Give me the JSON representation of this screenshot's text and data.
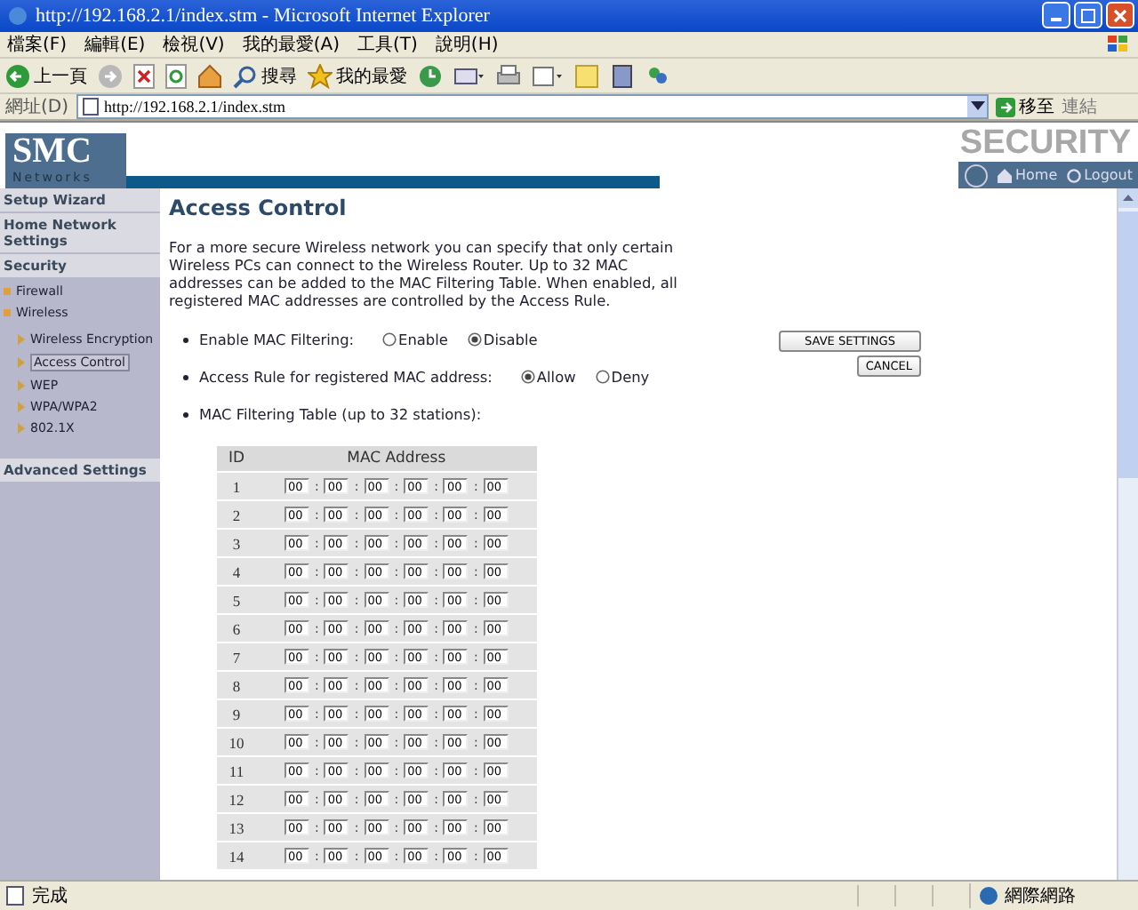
{
  "window": {
    "title": "http://192.168.2.1/index.stm - Microsoft Internet Explorer"
  },
  "menu": [
    "檔案(F)",
    "編輯(E)",
    "檢視(V)",
    "我的最愛(A)",
    "工具(T)",
    "說明(H)"
  ],
  "toolbar": [
    {
      "label": "上一頁"
    },
    {
      "label": "搜尋"
    },
    {
      "label": "我的最愛"
    }
  ],
  "address": {
    "label": "網址(D)",
    "value": "http://192.168.2.1/index.stm",
    "go": "移至",
    "links": "連結"
  },
  "header": {
    "logo": "SMC",
    "logo_sub": "Networks",
    "section": "SECURITY",
    "links": [
      "Home",
      "Logout"
    ]
  },
  "sidebar": [
    {
      "label": "Setup Wizard",
      "selected": false
    },
    {
      "label": "Home Network Settings",
      "selected": false
    },
    {
      "label": "Security",
      "selected": false,
      "children": [
        {
          "label": "Firewall",
          "selected": false
        },
        {
          "label": "Wireless",
          "selected": false,
          "children": [
            {
              "label": "Wireless Encryption",
              "selected": false
            },
            {
              "label": "Access Control",
              "selected": true
            },
            {
              "label": "WEP",
              "selected": false
            },
            {
              "label": "WPA/WPA2",
              "selected": false
            },
            {
              "label": "802.1X",
              "selected": false
            }
          ]
        }
      ]
    },
    {
      "label": "Advanced Settings",
      "selected": false
    }
  ],
  "heading": "Access Control",
  "description": "For a more secure Wireless network you can specify that only certain Wireless PCs can connect to the Wireless Router. Up to 32 MAC addresses can be added to the MAC Filtering Table. When enabled, all registered MAC addresses are controlled by the Access Rule.",
  "options": [
    {
      "label": "Enable MAC Filtering:",
      "choices": [
        {
          "label": "Enable",
          "selected": false
        },
        {
          "label": "Disable",
          "selected": true
        }
      ]
    },
    {
      "label": "Access Rule for registered MAC address:",
      "choices": [
        {
          "label": "Allow",
          "selected": true
        },
        {
          "label": "Deny",
          "selected": false
        }
      ]
    },
    {
      "label": "MAC Filtering Table (up to 32 stations):"
    }
  ],
  "buttons": [
    "SAVE SETTINGS",
    "CANCEL"
  ],
  "table": {
    "columns": [
      "ID",
      "MAC Address"
    ],
    "separator": ":",
    "rows": [
      {
        "id": "1",
        "mac": [
          "00",
          "00",
          "00",
          "00",
          "00",
          "00"
        ]
      },
      {
        "id": "2",
        "mac": [
          "00",
          "00",
          "00",
          "00",
          "00",
          "00"
        ]
      },
      {
        "id": "3",
        "mac": [
          "00",
          "00",
          "00",
          "00",
          "00",
          "00"
        ]
      },
      {
        "id": "4",
        "mac": [
          "00",
          "00",
          "00",
          "00",
          "00",
          "00"
        ]
      },
      {
        "id": "5",
        "mac": [
          "00",
          "00",
          "00",
          "00",
          "00",
          "00"
        ]
      },
      {
        "id": "6",
        "mac": [
          "00",
          "00",
          "00",
          "00",
          "00",
          "00"
        ]
      },
      {
        "id": "7",
        "mac": [
          "00",
          "00",
          "00",
          "00",
          "00",
          "00"
        ]
      },
      {
        "id": "8",
        "mac": [
          "00",
          "00",
          "00",
          "00",
          "00",
          "00"
        ]
      },
      {
        "id": "9",
        "mac": [
          "00",
          "00",
          "00",
          "00",
          "00",
          "00"
        ]
      },
      {
        "id": "10",
        "mac": [
          "00",
          "00",
          "00",
          "00",
          "00",
          "00"
        ]
      },
      {
        "id": "11",
        "mac": [
          "00",
          "00",
          "00",
          "00",
          "00",
          "00"
        ]
      },
      {
        "id": "12",
        "mac": [
          "00",
          "00",
          "00",
          "00",
          "00",
          "00"
        ]
      },
      {
        "id": "13",
        "mac": [
          "00",
          "00",
          "00",
          "00",
          "00",
          "00"
        ]
      },
      {
        "id": "14",
        "mac": [
          "00",
          "00",
          "00",
          "00",
          "00",
          "00"
        ]
      }
    ]
  },
  "status_bar": {
    "text": "完成",
    "zone": "網際網路"
  }
}
